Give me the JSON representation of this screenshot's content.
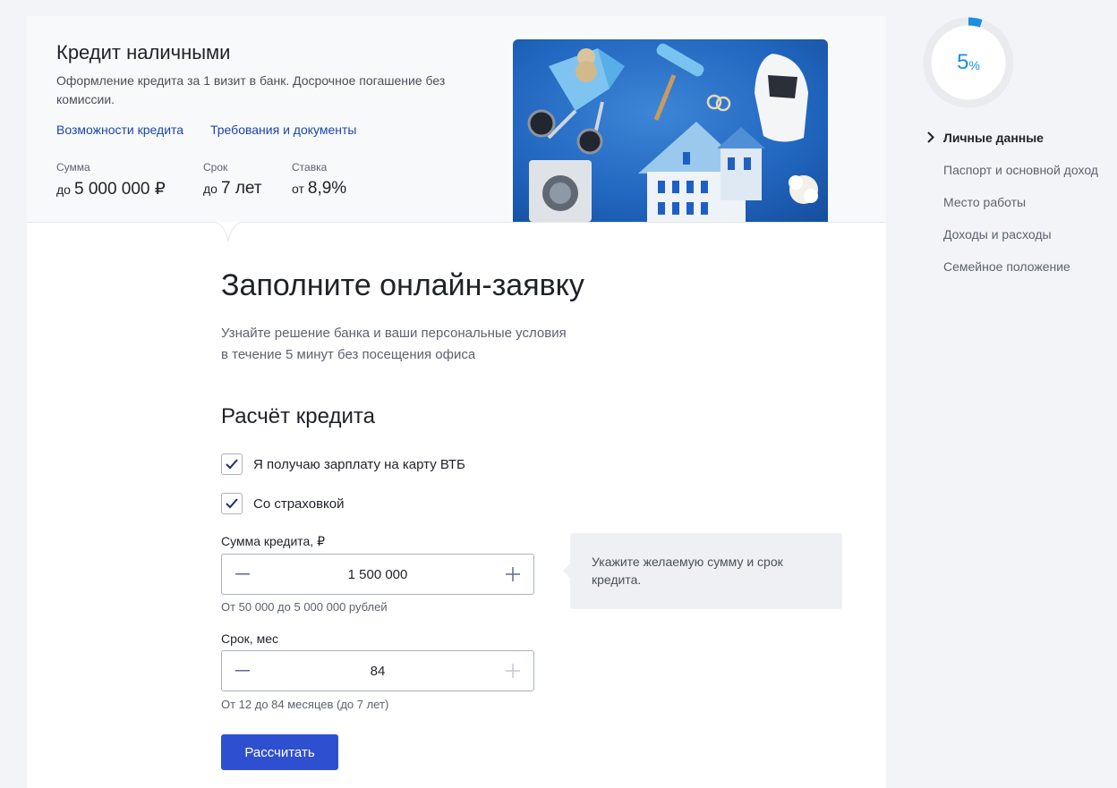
{
  "hero": {
    "title": "Кредит наличными",
    "description": "Оформление кредита за 1 визит в банк. Досрочное погашение без комиссии.",
    "links": [
      "Возможности кредита",
      "Требования и документы"
    ],
    "stats": [
      {
        "label": "Сумма",
        "prefix": "до",
        "value": "5 000 000 ₽"
      },
      {
        "label": "Срок",
        "prefix": "до",
        "value": "7 лет"
      },
      {
        "label": "Ставка",
        "prefix": "от",
        "value": "8,9%"
      }
    ]
  },
  "form": {
    "title": "Заполните онлайн-заявку",
    "subtitle_line1": "Узнайте решение банка и ваши персональные условия",
    "subtitle_line2": "в течение 5 минут без посещения офиса",
    "section_title": "Расчёт кредита",
    "checkboxes": [
      {
        "label": "Я получаю зарплату на карту ВТБ",
        "checked": true
      },
      {
        "label": "Со страховкой",
        "checked": true
      }
    ],
    "sum": {
      "label": "Сумма кредита, ₽",
      "value": "1 500 000",
      "hint": "От 50 000 до 5 000 000 рублей"
    },
    "term": {
      "label": "Срок, мес",
      "value": "84",
      "hint": "От 12 до 84 месяцев (до 7 лет)"
    },
    "tooltip": "Укажите желаемую сумму и срок кредита.",
    "submit_label": "Рассчитать"
  },
  "progress": {
    "value": "5",
    "unit": "%",
    "fraction": 0.05
  },
  "steps": [
    {
      "label": "Личные данные",
      "active": true
    },
    {
      "label": "Паспорт и основной доход",
      "active": false
    },
    {
      "label": "Место работы",
      "active": false
    },
    {
      "label": "Доходы и расходы",
      "active": false
    },
    {
      "label": "Семейное положение",
      "active": false
    }
  ],
  "colors": {
    "accent": "#2f4fd1",
    "link": "#1b45a8",
    "progress": "#1b8fe0"
  },
  "icons": [
    "minus-icon",
    "plus-icon",
    "check-icon",
    "chevron-right-icon"
  ]
}
